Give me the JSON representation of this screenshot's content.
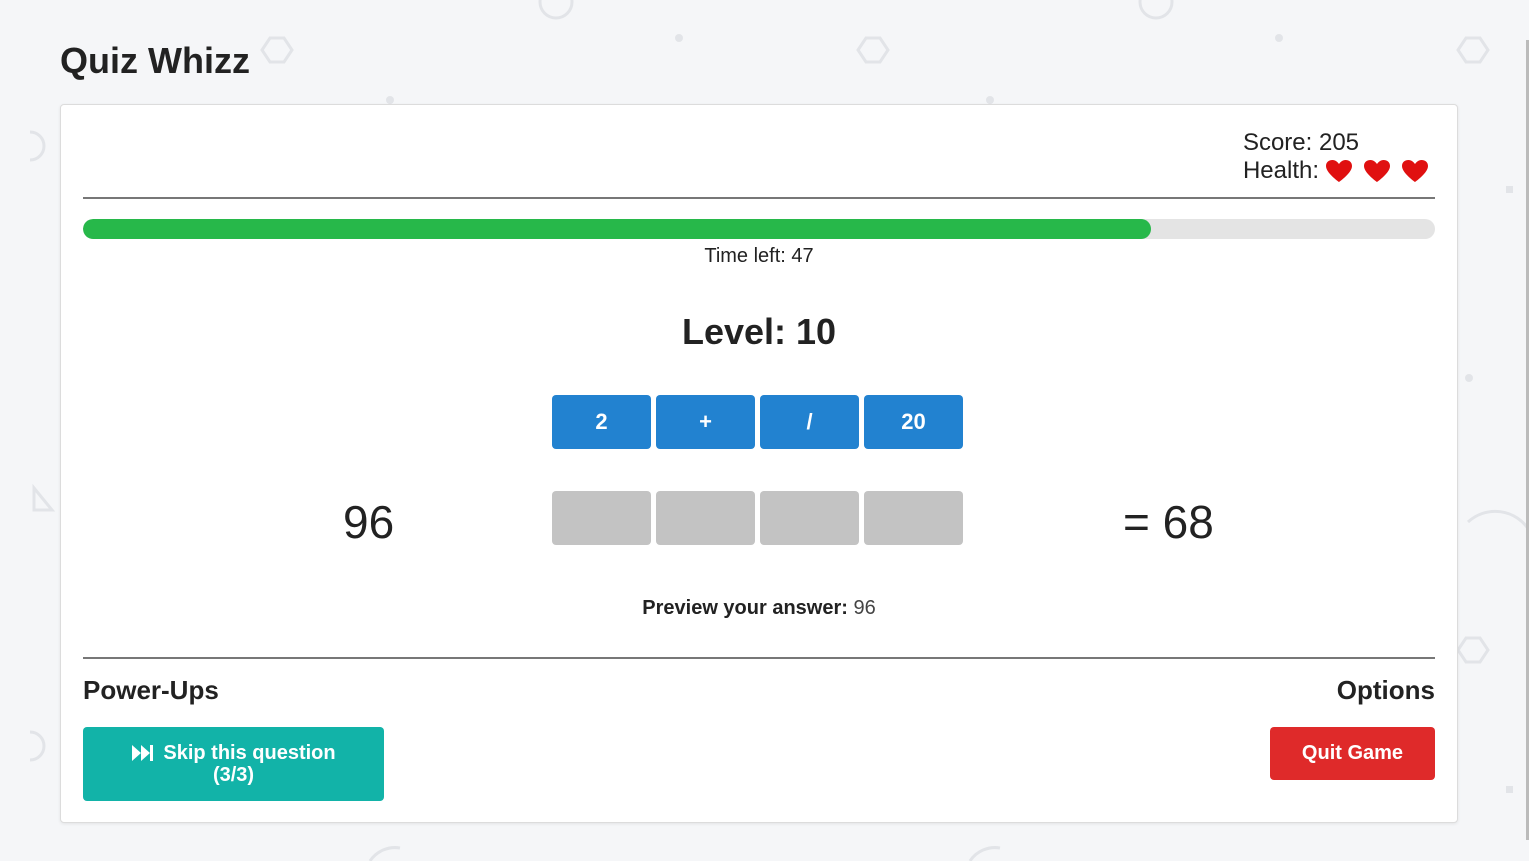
{
  "app": {
    "title": "Quiz Whizz"
  },
  "stats": {
    "score_label": "Score: 205",
    "health_label": "Health:",
    "hearts": 3
  },
  "timer": {
    "fraction_remaining": 0.79,
    "label": "Time left: 47"
  },
  "level": {
    "label": "Level: 10"
  },
  "puzzle": {
    "tiles": [
      "2",
      "+",
      "/",
      "20"
    ],
    "slots_count": 4,
    "start_number": "96",
    "target": "= 68"
  },
  "preview": {
    "label": "Preview your answer:",
    "value": "96"
  },
  "powerups": {
    "title": "Power-Ups",
    "skip_line1": "Skip this question",
    "skip_line2": "(3/3)"
  },
  "options": {
    "title": "Options",
    "quit_label": "Quit Game"
  },
  "colors": {
    "progress": "#27b84a",
    "tile": "#2282d0",
    "slot": "#c3c3c3",
    "skip": "#12b3a8",
    "quit": "#df2a2a",
    "heart": "#e01010"
  }
}
